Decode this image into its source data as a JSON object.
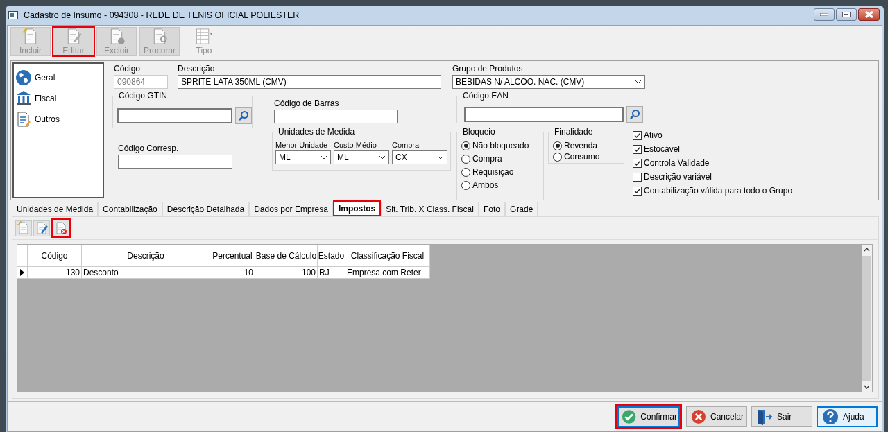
{
  "window": {
    "title": "Cadastro de Insumo - 094308 - REDE DE TENIS OFICIAL POLIESTER"
  },
  "toolbar": [
    {
      "label": "Incluir",
      "kind": "add",
      "disabled": true,
      "highlighted": false
    },
    {
      "label": "Editar",
      "kind": "edit",
      "disabled": true,
      "highlighted": true
    },
    {
      "label": "Excluir",
      "kind": "delete",
      "disabled": true,
      "highlighted": false
    },
    {
      "label": "Procurar",
      "kind": "search",
      "disabled": true,
      "highlighted": false
    },
    {
      "label": "Tipo",
      "kind": "view",
      "disabled": true,
      "highlighted": false
    }
  ],
  "sidebar": {
    "items": [
      {
        "label": "Geral",
        "kind": "globe"
      },
      {
        "label": "Fiscal",
        "kind": "bank"
      },
      {
        "label": "Outros",
        "kind": "document"
      }
    ]
  },
  "form": {
    "codigo": {
      "label": "Código",
      "value": "090864",
      "disabled": true
    },
    "descricao": {
      "label": "Descrição",
      "value": "SPRITE LATA 350ML (CMV)"
    },
    "grupo": {
      "label": "Grupo de Produtos",
      "value": "BEBIDAS N/ ALCOO. NAC. (CMV)"
    },
    "gtin": {
      "label": "Código GTIN"
    },
    "barras": {
      "label": "Código de Barras"
    },
    "ean": {
      "label": "Código EAN"
    },
    "corresp": {
      "label": "Código Corresp."
    },
    "unidades": {
      "title": "Unidades de Medida",
      "fields": [
        {
          "label": "Menor Unidade",
          "value": "ML"
        },
        {
          "label": "Custo Médio",
          "value": "ML"
        },
        {
          "label": "Compra",
          "value": "CX"
        }
      ]
    },
    "bloqueio": {
      "title": "Bloqueio",
      "options": [
        {
          "label": "Não bloqueado",
          "selected": true
        },
        {
          "label": "Compra",
          "selected": false
        },
        {
          "label": "Requisição",
          "selected": false
        },
        {
          "label": "Ambos",
          "selected": false
        }
      ]
    },
    "finalidade": {
      "title": "Finalidade",
      "options": [
        {
          "label": "Revenda",
          "selected": true
        },
        {
          "label": "Consumo",
          "selected": false
        }
      ]
    },
    "flags": [
      {
        "label": "Ativo",
        "checked": true
      },
      {
        "label": "Estocável",
        "checked": true
      },
      {
        "label": "Controla Validade",
        "checked": true
      },
      {
        "label": "Descrição variável",
        "checked": false
      },
      {
        "label": "Contabilização válida para todo o Grupo",
        "checked": true
      }
    ]
  },
  "tabs": [
    {
      "label": "Unidades de Medida",
      "selected": false,
      "highlighted": false
    },
    {
      "label": "Contabilização",
      "selected": false,
      "highlighted": false
    },
    {
      "label": "Descrição Detalhada",
      "selected": false,
      "highlighted": false
    },
    {
      "label": "Dados por Empresa",
      "selected": false,
      "highlighted": false
    },
    {
      "label": "Impostos",
      "selected": true,
      "highlighted": true
    },
    {
      "label": "Sit. Trib. X Class. Fiscal",
      "selected": false,
      "highlighted": false
    },
    {
      "label": "Foto",
      "selected": false,
      "highlighted": false
    },
    {
      "label": "Grade",
      "selected": false,
      "highlighted": false
    }
  ],
  "subtoolbar": [
    {
      "kind": "add",
      "highlighted": false
    },
    {
      "kind": "edit",
      "highlighted": false
    },
    {
      "kind": "delete",
      "highlighted": true
    }
  ],
  "table": {
    "columns": [
      {
        "label": "Código"
      },
      {
        "label": "Descrição"
      },
      {
        "label": "Percentual"
      },
      {
        "label": "Base de Cálculo"
      },
      {
        "label": "Estado"
      },
      {
        "label": "Classificação Fiscal"
      }
    ],
    "rows": [
      {
        "current": true,
        "cells": [
          "130",
          "Desconto",
          "10",
          "100",
          "RJ",
          "Empresa com Reter"
        ]
      }
    ]
  },
  "buttons": [
    {
      "label": "Confirmar",
      "kind": "confirm",
      "focused": true,
      "highlighted": true
    },
    {
      "label": "Cancelar",
      "kind": "cancel",
      "focused": false,
      "highlighted": false
    },
    {
      "label": "Sair",
      "kind": "exit",
      "focused": false,
      "highlighted": false
    },
    {
      "label": "Ajuda",
      "kind": "help",
      "focused": true,
      "highlighted": false
    }
  ]
}
